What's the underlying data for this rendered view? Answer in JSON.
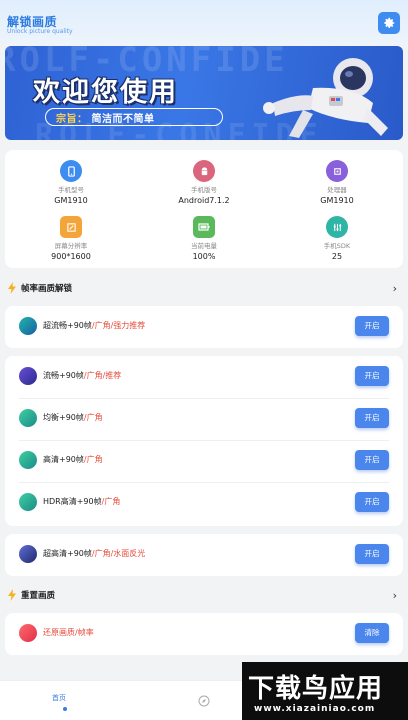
{
  "header": {
    "title": "解锁画质",
    "subtitle": "Unlock picture quality"
  },
  "banner": {
    "headline": "欢迎您使用",
    "bg_text": "ROLF-CONFIDE",
    "pill_key": "宗旨：",
    "pill_text": "简洁而不简单"
  },
  "device_info": [
    {
      "label": "手机型号",
      "value": "GM1910",
      "icon": "phone-icon",
      "color": "#3f8cf0"
    },
    {
      "label": "手机版号",
      "value": "Android7.1.2",
      "icon": "android-icon",
      "color": "#d9667c"
    },
    {
      "label": "处理器",
      "value": "GM1910",
      "icon": "cpu-icon",
      "color": "#8a5fdb"
    },
    {
      "label": "屏幕分辨率",
      "value": "900*1600",
      "icon": "resolution-icon",
      "color": "#f3a53a"
    },
    {
      "label": "当前电量",
      "value": "100%",
      "icon": "battery-icon",
      "color": "#5bb95b"
    },
    {
      "label": "手机SDK",
      "value": "25",
      "icon": "sdk-icon",
      "color": "#2fb5a5"
    }
  ],
  "section_unlock": {
    "title": "帧率画质解锁"
  },
  "section_reset": {
    "title": "重置画质"
  },
  "options": [
    {
      "name": "超流畅+90帧",
      "tag": "/广角/强力推荐",
      "button": "开启",
      "color1": "#1fb5a6",
      "color2": "#1a5fa8"
    },
    {
      "name": "流畅+90帧",
      "tag": "/广角/推荐",
      "button": "开启",
      "color1": "#6a4fd8",
      "color2": "#2b2b8a"
    },
    {
      "name": "均衡+90帧",
      "tag": "/广角",
      "button": "开启",
      "color1": "#3fd0a0",
      "color2": "#1b8a8a"
    },
    {
      "name": "高清+90帧",
      "tag": "/广角",
      "button": "开启",
      "color1": "#3fd0a0",
      "color2": "#1b8a8a"
    },
    {
      "name": "HDR高清+90帧",
      "tag": "/广角",
      "button": "开启",
      "color1": "#3fd0a0",
      "color2": "#1b8a8a"
    },
    {
      "name": "超高清+90帧",
      "tag": "/广角/水面反光",
      "button": "开启",
      "color1": "#5f6fd8",
      "color2": "#1f2a6a"
    },
    {
      "name": "还原画质/帧率",
      "tag": "",
      "button": "清除",
      "color1": "#ff6a6a",
      "color2": "#e0304a"
    }
  ],
  "nav": {
    "home_label": "首页"
  },
  "watermark": {
    "main": "下载鸟应用",
    "url": "www.xiazainiao.com"
  }
}
